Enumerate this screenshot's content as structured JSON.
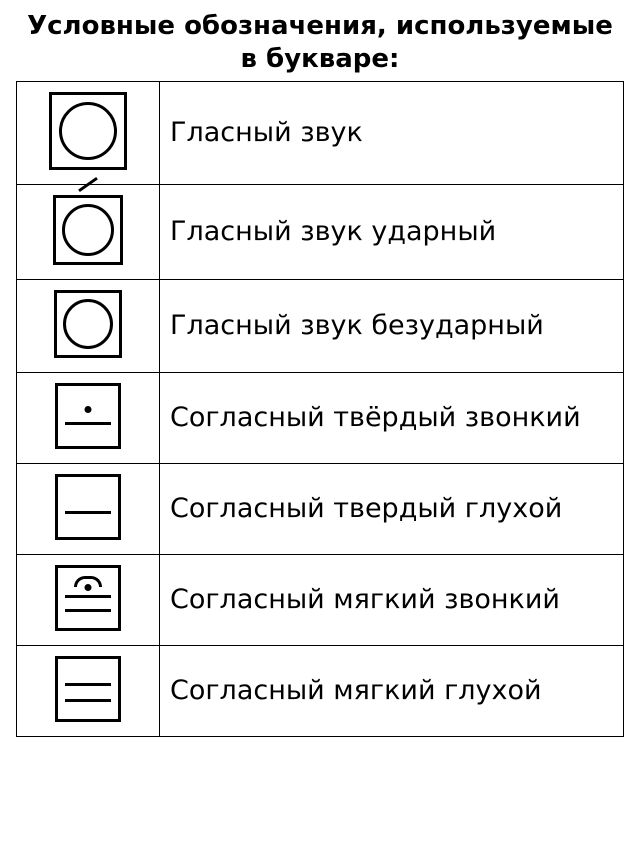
{
  "title": "Условные обозначения, используемые в букваре:",
  "rows": [
    {
      "symbol": "vowel",
      "label": "Гласный звук"
    },
    {
      "symbol": "vowel_stressed",
      "label": "Гласный звук ударный"
    },
    {
      "symbol": "vowel_unstressed",
      "label": "Гласный звук безударный"
    },
    {
      "symbol": "cons_hard_voiced",
      "label": "Согласный твёрдый звонкий"
    },
    {
      "symbol": "cons_hard_voiceless",
      "label": "Согласный твердый глухой"
    },
    {
      "symbol": "cons_soft_voiced",
      "label": "Согласный мягкий звонкий"
    },
    {
      "symbol": "cons_soft_voiceless",
      "label": "Согласный мягкий глухой"
    }
  ]
}
